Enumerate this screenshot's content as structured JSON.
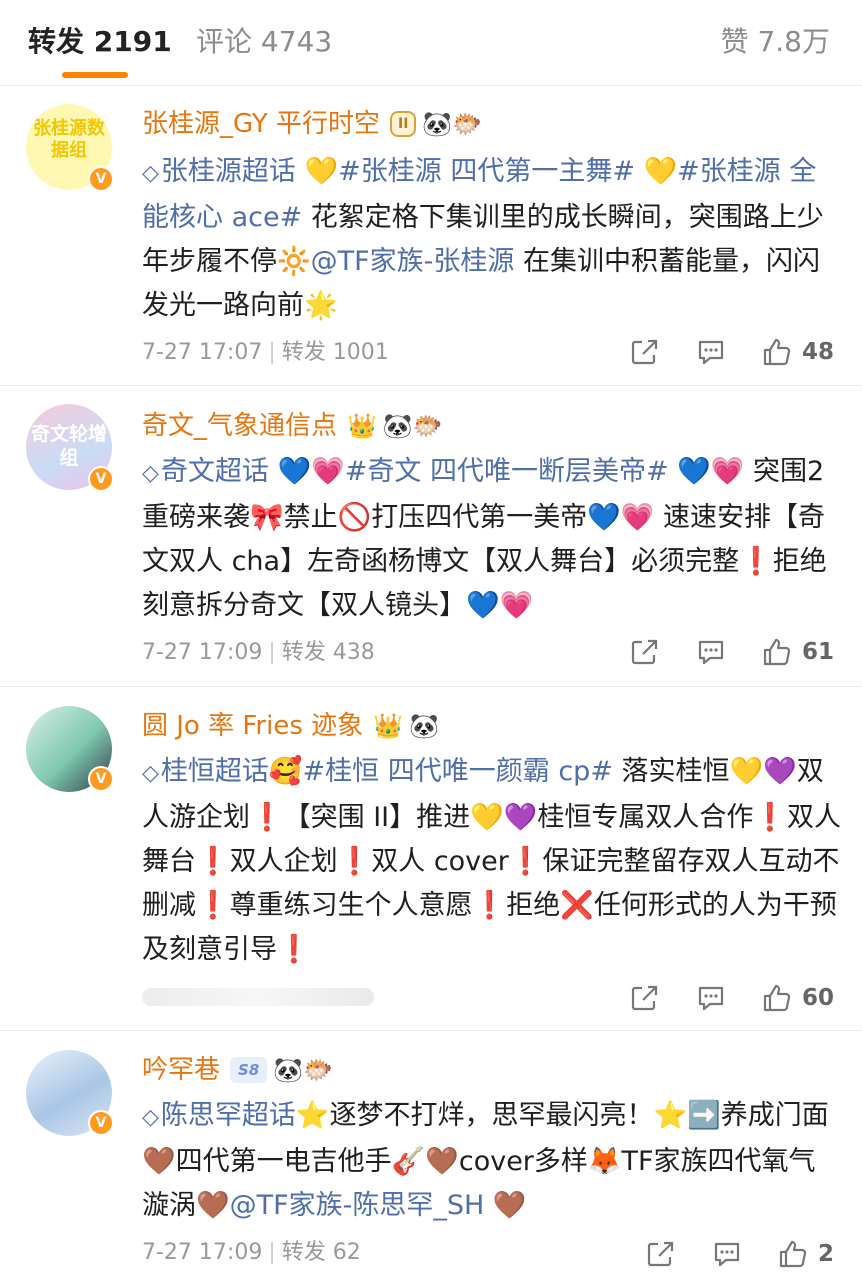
{
  "tabs": {
    "repost": "转发 2191",
    "comments": "评论 4743",
    "likes": "赞 7.8万"
  },
  "posts": [
    {
      "avatar_text": "张桂源数据组",
      "username": "张桂源_GY 平行时空",
      "badge": "II",
      "badge_emojis": "🐼🐡",
      "content": [
        {
          "t": "diamond",
          "v": "◇"
        },
        {
          "t": "hl",
          "v": "张桂源超话"
        },
        {
          "t": "txt",
          "v": " 💛"
        },
        {
          "t": "hl",
          "v": "#张桂源 四代第一主舞#"
        },
        {
          "t": "txt",
          "v": " 💛"
        },
        {
          "t": "hl",
          "v": "#张桂源 全能核心 ace#"
        },
        {
          "t": "txt",
          "v": " 花絮定格下集训里的成长瞬间，突围路上少年步履不停🔆"
        },
        {
          "t": "hl",
          "v": "@TF家族-张桂源"
        },
        {
          "t": "txt",
          "v": " 在集训中积蓄能量，闪闪发光一路向前🌟"
        }
      ],
      "time": "7-27 17:07",
      "repost": "转发 1001",
      "likes": "48"
    },
    {
      "avatar_text": "奇文轮增组",
      "username": "奇文_气象通信点",
      "badge": "👑",
      "badge_emojis": "🐼🐡",
      "content": [
        {
          "t": "diamond",
          "v": "◇"
        },
        {
          "t": "hl",
          "v": "奇文超话"
        },
        {
          "t": "txt",
          "v": " 💙💗"
        },
        {
          "t": "hl",
          "v": "#奇文 四代唯一断层美帝#"
        },
        {
          "t": "txt",
          "v": " 💙💗 突围2重磅来袭🎀禁止🚫打压四代第一美帝💙💗 速速安排【奇文双人 cha】左奇函杨博文【双人舞台】必须完整❗拒绝刻意拆分奇文【双人镜头】💙💗"
        }
      ],
      "time": "7-27 17:09",
      "repost": "转发 438",
      "likes": "61"
    },
    {
      "avatar_text": "",
      "username": "圆 Jo 率 Fries 迹象",
      "badge": "👑",
      "badge_emojis": "🐼",
      "content": [
        {
          "t": "diamond",
          "v": "◇"
        },
        {
          "t": "hl",
          "v": "桂恒超话"
        },
        {
          "t": "txt",
          "v": "🥰"
        },
        {
          "t": "hl",
          "v": "#桂恒 四代唯一颜霸 cp#"
        },
        {
          "t": "txt",
          "v": " 落实桂恒💛💜双人游企划❗【突围 II】推进💛💜桂恒专属双人合作❗双人舞台❗双人企划❗双人 cover❗保证完整留存双人互动不删减❗尊重练习生个人意愿❗拒绝❌任何形式的人为干预及刻意引导❗"
        }
      ],
      "time": "",
      "repost": "",
      "likes": "60"
    },
    {
      "avatar_text": "",
      "username": "吟罕巷",
      "badge": "S8",
      "badge_emojis": "🐼🐡",
      "content": [
        {
          "t": "diamond",
          "v": "◇"
        },
        {
          "t": "hl",
          "v": "陈思罕超话"
        },
        {
          "t": "txt",
          "v": "⭐逐梦不打烊，思罕最闪亮！⭐➡️养成门面🤎四代第一电吉他手🎸🤎cover多样🦊TF家族四代氧气漩涡🤎"
        },
        {
          "t": "hl",
          "v": "@TF家族-陈思罕_SH"
        },
        {
          "t": "txt",
          "v": " 🤎"
        }
      ],
      "time": "7-27 17:09",
      "repost": "转发 62",
      "likes": "2"
    }
  ],
  "colors": {
    "accent": "#ff8200",
    "username": "#e8760f",
    "link": "#4f6eaa"
  }
}
